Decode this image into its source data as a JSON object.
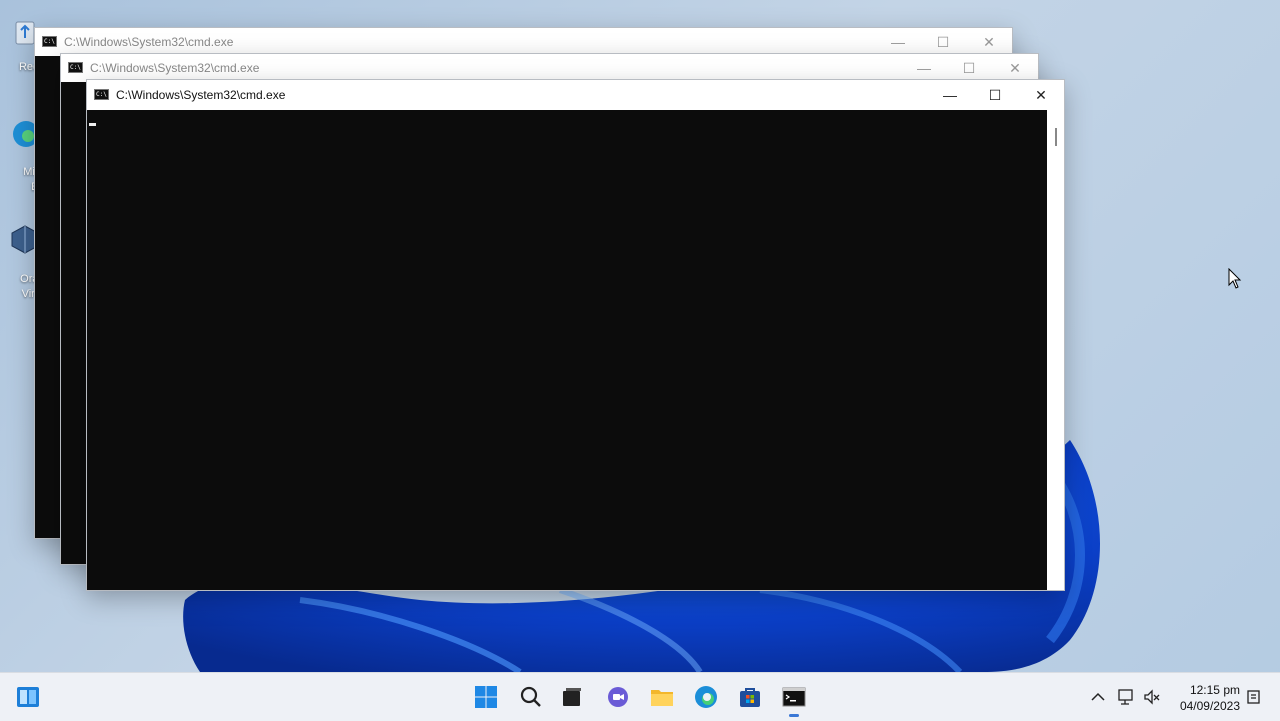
{
  "desktop": {
    "icons": [
      {
        "label": "Recy",
        "icon": "recycle-bin-icon"
      },
      {
        "label": "Micr",
        "label2": "Ec",
        "icon": "edge-shortcut-icon"
      },
      {
        "label": "Orac",
        "label2": "Virtu",
        "icon": "virtualbox-shortcut-icon"
      }
    ]
  },
  "windows": [
    {
      "title": "C:\\Windows\\System32\\cmd.exe",
      "state": "inactive"
    },
    {
      "title": "C:\\Windows\\System32\\cmd.exe",
      "state": "inactive"
    },
    {
      "title": "C:\\Windows\\System32\\cmd.exe",
      "state": "active"
    }
  ],
  "window_buttons": {
    "minimize": "—",
    "maximize": "☐",
    "close": "✕"
  },
  "taskbar": {
    "items": [
      "widgets",
      "start",
      "search",
      "task-view",
      "chat",
      "file-explorer",
      "edge",
      "store",
      "command-prompt"
    ],
    "active_item": "command-prompt"
  },
  "tray": {
    "time": "12:15 pm",
    "date": "04/09/2023"
  },
  "colors": {
    "console_bg": "#0c0c0c",
    "accent": "#3a78d6",
    "taskbar_bg": "#eef1f6"
  }
}
